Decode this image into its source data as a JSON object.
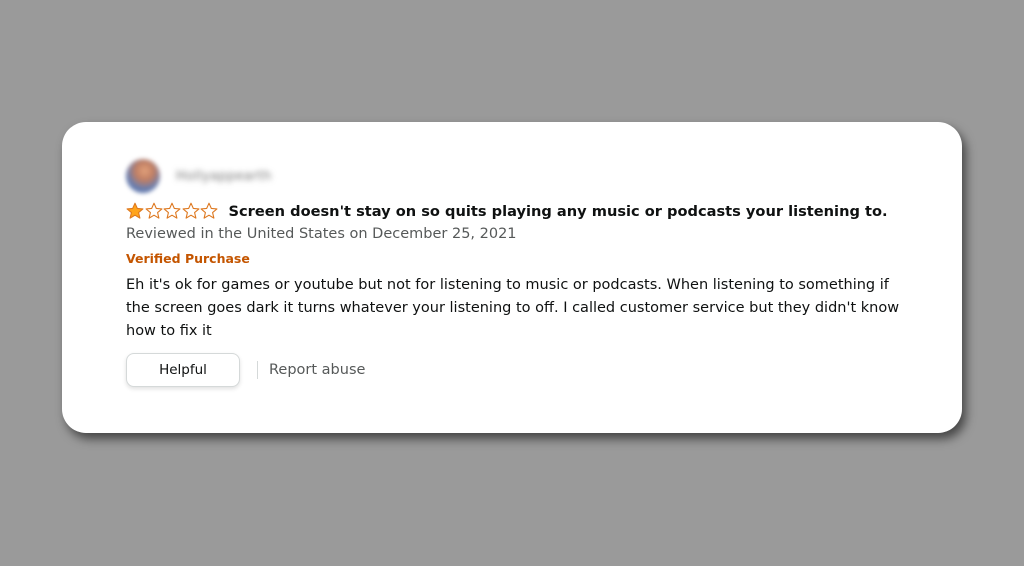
{
  "review": {
    "reviewer_name": "Hollyappearth",
    "rating": 1,
    "max_rating": 5,
    "star_filled_color": "#ffa41c",
    "star_outline_color": "#de7921",
    "title": "Screen doesn't stay on so quits playing any music or podcasts your listening to.",
    "meta": "Reviewed in the United States on December 25, 2021",
    "verified_label": "Verified Purchase",
    "body": "Eh it's ok for games or youtube but not for listening to music or podcasts. When listening to something if the screen goes dark it turns whatever your listening to off. I called customer service but they didn't know how to fix it",
    "helpful_label": "Helpful",
    "report_label": "Report abuse"
  }
}
